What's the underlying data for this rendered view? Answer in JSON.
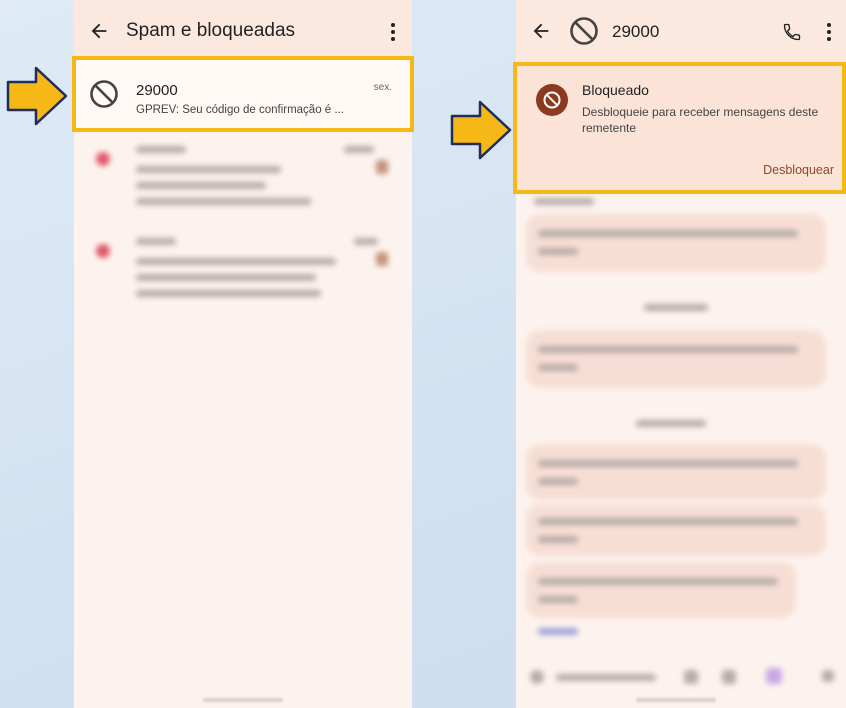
{
  "left_screen": {
    "title": "Spam e bloqueadas",
    "item": {
      "name": "29000",
      "date": "sex.",
      "preview": "GPREV: Seu código de confirmação é ..."
    }
  },
  "right_screen": {
    "title": "29000",
    "card": {
      "title": "Bloqueado",
      "description": "Desbloqueie para receber mensagens deste remetente",
      "action": "Desbloquear"
    }
  },
  "colors": {
    "highlight": "#f6b817",
    "arrow": "#f6b817",
    "blocked_badge": "#8b3a1f"
  }
}
